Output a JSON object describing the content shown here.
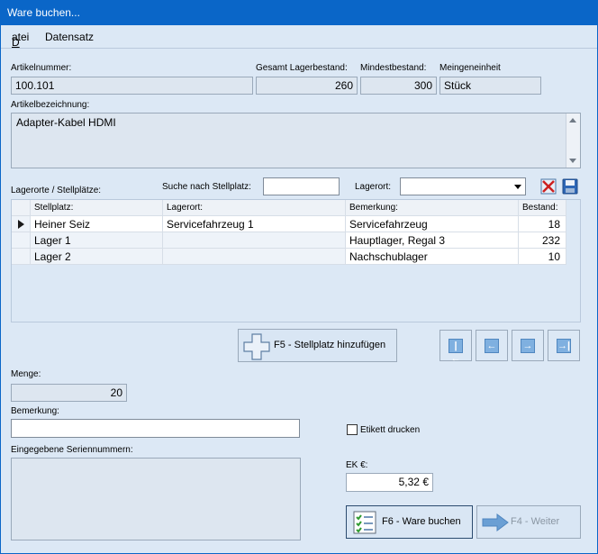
{
  "window": {
    "title": "Ware buchen..."
  },
  "menu": {
    "items": [
      "Datei",
      "Datensatz"
    ]
  },
  "article": {
    "nummer_label": "Artikelnummer:",
    "nummer_value": "100.101",
    "gesamt_label": "Gesamt Lagerbestand:",
    "gesamt_value": "260",
    "mindest_label": "Mindestbestand:",
    "mindest_value": "300",
    "einheit_label": "Meingeneinheit",
    "einheit_value": "Stück",
    "bezeichnung_label": "Artikelbezeichnung:",
    "bezeichnung_value": "Adapter-Kabel HDMI"
  },
  "storage": {
    "section_label": "Lagerorte / Stellplätze:",
    "search_label": "Suche nach Stellplatz:",
    "search_value": "",
    "lagerort_label": "Lagerort:",
    "lagerort_value": "",
    "columns": [
      "Stellplatz:",
      "Lagerort:",
      "Bemerkung:",
      "Bestand:"
    ],
    "rows": [
      {
        "stellplatz": "Heiner Seiz",
        "lagerort": "Servicefahrzeug 1",
        "bemerkung": "Servicefahrzeug",
        "bestand": "18"
      },
      {
        "stellplatz": "Lager 1",
        "lagerort": "",
        "bemerkung": "Hauptlager, Regal 3",
        "bestand": "232"
      },
      {
        "stellplatz": "Lager 2",
        "lagerort": "",
        "bemerkung": "Nachschublager",
        "bestand": "10"
      }
    ],
    "add_button": "F5 - Stellplatz hinzufügen"
  },
  "booking": {
    "menge_label": "Menge:",
    "menge_value": "20",
    "bemerkung_label": "Bemerkung:",
    "bemerkung_value": "",
    "serien_label": "Eingegebene Seriennummern:",
    "etikett_label": "Etikett drucken",
    "ek_label": "EK €:",
    "ek_value": "5,32 €",
    "book_button": "F6 - Ware buchen",
    "next_button": "F4 - Weiter"
  },
  "colors": {
    "titlebar": "#0a66c8",
    "panel": "#dce8f5",
    "accent": "#4f86bf"
  }
}
